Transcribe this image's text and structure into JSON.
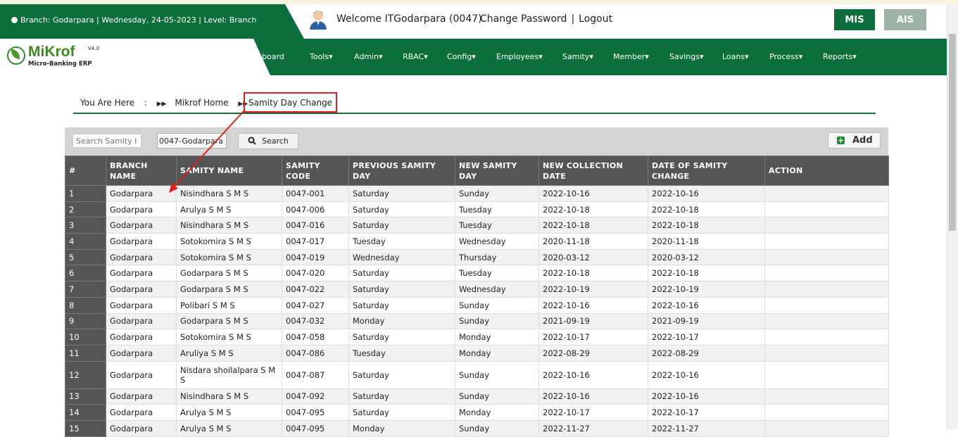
{
  "header": {
    "info": "Branch: Godarpara | Wednesday, 24-05-2023 | Level: Branch",
    "welcome": "Welcome ITGodarpara (0047)",
    "change_password": "Change Password",
    "separator": "|",
    "logout": "Logout",
    "mis_label": "MIS",
    "ais_label": "AIS"
  },
  "logo": {
    "name": "MiKrof",
    "version": "V4.0",
    "tagline": "Micro-Banking ERP"
  },
  "nav": {
    "items": [
      "board",
      "Tools",
      "Admin",
      "RBAC",
      "Config",
      "Employees",
      "Samity",
      "Member",
      "Savings",
      "Loans",
      "Process",
      "Reports"
    ],
    "dropdown_marker": "▾"
  },
  "breadcrumb": {
    "you_are_here": "You Are Here",
    "colon": ":",
    "home": "Mikrof Home",
    "current": "Samity Day Change"
  },
  "toolbar": {
    "search_placeholder": "Search Samity I",
    "branch_value": "0047-Godarpara",
    "search_label": "Search",
    "add_label": "Add"
  },
  "table": {
    "headers": {
      "num": "#",
      "branch": "BRANCH NAME",
      "samity_name": "SAMITY NAME",
      "samity_code": "SAMITY CODE",
      "prev_day": "PREVIOUS SAMITY DAY",
      "new_day": "NEW SAMITY DAY",
      "new_collection": "NEW COLLECTION DATE",
      "date_change": "DATE OF SAMITY CHANGE",
      "action": "ACTION"
    },
    "rows": [
      {
        "n": "1",
        "branch": "Godarpara",
        "name": "Nisindhara S M S",
        "code": "0047-001",
        "prev": "Saturday",
        "new": "Sunday",
        "collection": "2022-10-16",
        "changed": "2022-10-16"
      },
      {
        "n": "2",
        "branch": "Godarpara",
        "name": "Arulya S M S",
        "code": "0047-006",
        "prev": "Saturday",
        "new": "Tuesday",
        "collection": "2022-10-18",
        "changed": "2022-10-18"
      },
      {
        "n": "3",
        "branch": "Godarpara",
        "name": "Nisindhara S M S",
        "code": "0047-016",
        "prev": "Saturday",
        "new": "Tuesday",
        "collection": "2022-10-18",
        "changed": "2022-10-18"
      },
      {
        "n": "4",
        "branch": "Godarpara",
        "name": "Sotokomira S M S",
        "code": "0047-017",
        "prev": "Tuesday",
        "new": "Wednesday",
        "collection": "2020-11-18",
        "changed": "2020-11-18"
      },
      {
        "n": "5",
        "branch": "Godarpara",
        "name": "Sotokomira S M S",
        "code": "0047-019",
        "prev": "Wednesday",
        "new": "Thursday",
        "collection": "2020-03-12",
        "changed": "2020-03-12"
      },
      {
        "n": "6",
        "branch": "Godarpara",
        "name": "Godarpara S M S",
        "code": "0047-020",
        "prev": "Saturday",
        "new": "Tuesday",
        "collection": "2022-10-18",
        "changed": "2022-10-18"
      },
      {
        "n": "7",
        "branch": "Godarpara",
        "name": "Godarpara S M S",
        "code": "0047-022",
        "prev": "Saturday",
        "new": "Wednesday",
        "collection": "2022-10-19",
        "changed": "2022-10-19"
      },
      {
        "n": "8",
        "branch": "Godarpara",
        "name": "Polibari S M S",
        "code": "0047-027",
        "prev": "Saturday",
        "new": "Sunday",
        "collection": "2022-10-16",
        "changed": "2022-10-16"
      },
      {
        "n": "9",
        "branch": "Godarpara",
        "name": "Godarpara S M S",
        "code": "0047-032",
        "prev": "Monday",
        "new": "Sunday",
        "collection": "2021-09-19",
        "changed": "2021-09-19"
      },
      {
        "n": "10",
        "branch": "Godarpara",
        "name": "Sotokomira S M S",
        "code": "0047-058",
        "prev": "Saturday",
        "new": "Monday",
        "collection": "2022-10-17",
        "changed": "2022-10-17"
      },
      {
        "n": "11",
        "branch": "Godarpara",
        "name": "Aruliya S M S",
        "code": "0047-086",
        "prev": "Tuesday",
        "new": "Monday",
        "collection": "2022-08-29",
        "changed": "2022-08-29"
      },
      {
        "n": "12",
        "branch": "Godarpara",
        "name": "Nisdara shoilalpara S M S",
        "code": "0047-087",
        "prev": "Saturday",
        "new": "Sunday",
        "collection": "2022-10-16",
        "changed": "2022-10-16"
      },
      {
        "n": "13",
        "branch": "Godarpara",
        "name": "Nisindhara S M S",
        "code": "0047-092",
        "prev": "Saturday",
        "new": "Sunday",
        "collection": "2022-10-16",
        "changed": "2022-10-16"
      },
      {
        "n": "14",
        "branch": "Godarpara",
        "name": "Arulya S M S",
        "code": "0047-095",
        "prev": "Saturday",
        "new": "Monday",
        "collection": "2022-10-17",
        "changed": "2022-10-17"
      },
      {
        "n": "15",
        "branch": "Godarpara",
        "name": "Arulya S M S",
        "code": "0047-095",
        "prev": "Monday",
        "new": "Sunday",
        "collection": "2022-11-27",
        "changed": "2022-11-27"
      }
    ]
  },
  "colors": {
    "brand_green": "#0c6e3a",
    "table_header": "#555555",
    "highlight_red": "#e02020"
  }
}
